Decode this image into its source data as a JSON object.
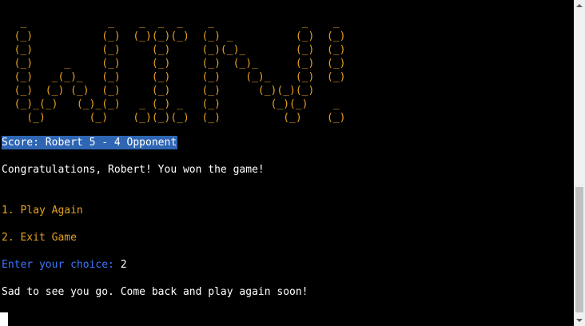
{
  "terminal": {
    "ascii_art": "   _             _    _  _  _    _              _    _\n  (_)           (_)  (_)(_)(_)  (_) _          (_)  (_)\n  (_)           (_)     (_)     (_)(_)_        (_)  (_)\n  (_)     _     (_)     (_)     (_)  (_)_      (_)  (_)\n  (_)   _(_)_   (_)     (_)     (_)    (_)_    (_)  (_)\n  (_)  (_) (_)  (_)     (_)     (_)      (_)(_)(_)\n  (_)_(_)   (_)_(_)   _ (_) _   (_)        (_)(_)    _\n    (_)       (_)    (_)(_)(_)  (_)          (_)    (_)",
    "score_text": "Score: Robert 5 - 4 Opponent",
    "congrats_text": "Congratulations, Robert! You won the game!",
    "menu": [
      {
        "label": "1. Play Again"
      },
      {
        "label": "2. Exit Game"
      }
    ],
    "prompt_label": "Enter your choice: ",
    "prompt_value": "2",
    "goodbye_text": "Sad to see you go. Come back and play again soon!"
  },
  "colors": {
    "background": "#000000",
    "ascii_art": "#e6a11f",
    "menu": "#e6a11f",
    "prompt": "#3b78ff",
    "selection": "#2f66b3",
    "text": "#ffffff"
  }
}
